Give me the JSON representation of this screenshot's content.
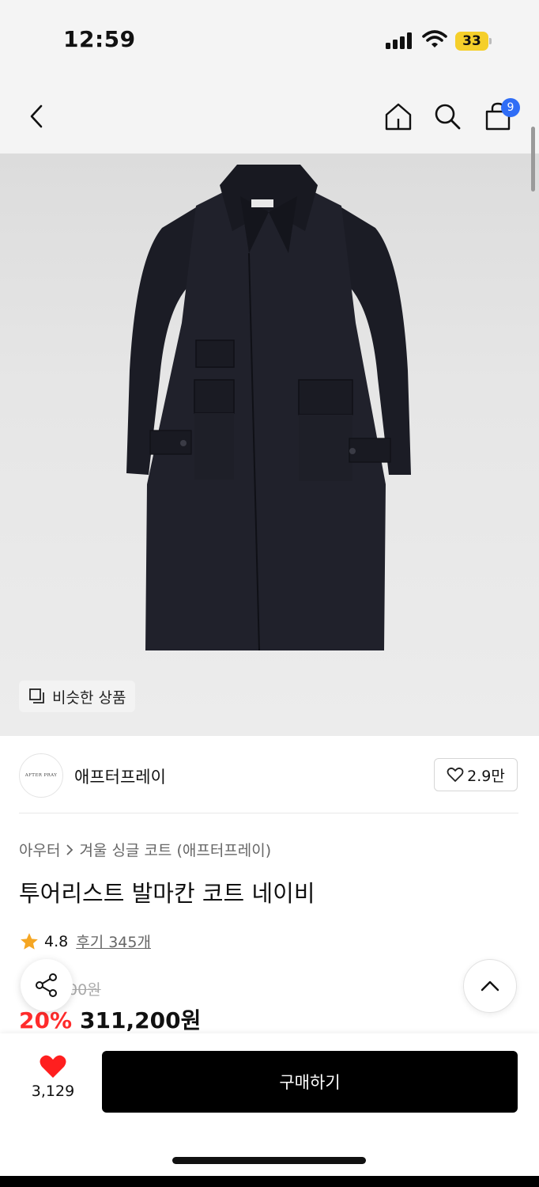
{
  "status_bar": {
    "time": "12:59",
    "battery": "33",
    "battery_color": "#f5cf2b"
  },
  "nav": {
    "back_icon": "chevron-left-icon",
    "home_icon": "home-icon",
    "search_icon": "search-icon",
    "cart_icon": "shopping-bag-icon",
    "cart_count": "9",
    "cart_badge_color": "#2f6df6"
  },
  "product_image": {
    "similar_label": "비슷한 상품"
  },
  "brand": {
    "logo_text": "AFTER PRAY",
    "name": "애프터프레이",
    "likes": "2.9만"
  },
  "product": {
    "breadcrumb": [
      "아우터",
      "겨울 싱글 코트 (애프터프레이)"
    ],
    "title": "투어리스트 발마칸 코트 네이비",
    "rating": "4.8",
    "reviews": "후기 345개",
    "original_price": "00원",
    "discount": "20%",
    "price": "311,200원",
    "discount_color": "#ff2b2b"
  },
  "bottom_bar": {
    "like_count": "3,129",
    "buy_label": "구매하기",
    "heart_color": "#ff1f1f"
  }
}
